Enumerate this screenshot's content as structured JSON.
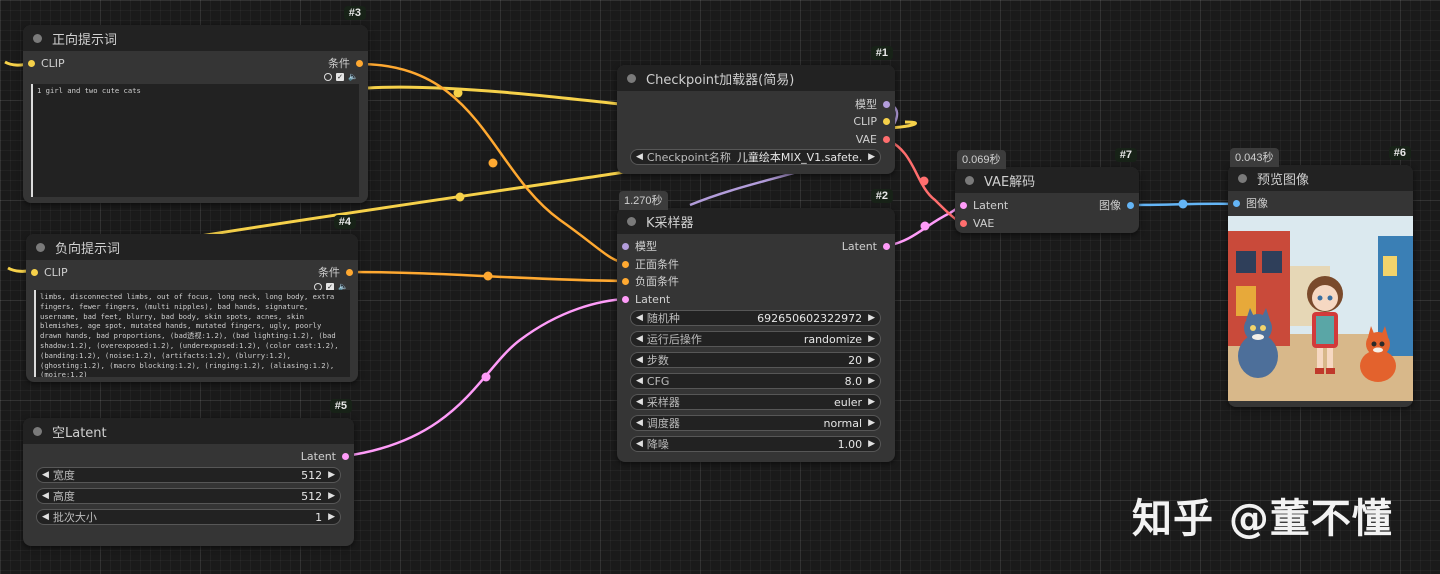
{
  "colors": {
    "clip": "#f6d14a",
    "conditioning": "#ffa931",
    "model": "#b39ddb",
    "vae": "#ff6e6e",
    "latent": "#ff9cf9",
    "image": "#64b5f6"
  },
  "nodes": {
    "positive_prompt": {
      "id": "#3",
      "title": "正向提示词",
      "input_clip": "CLIP",
      "output_condition": "条件",
      "text": "1 girl and two cute cats"
    },
    "checkpoint_loader": {
      "id": "#1",
      "title": "Checkpoint加载器(简易)",
      "output_model": "模型",
      "output_clip": "CLIP",
      "output_vae": "VAE",
      "ckpt_label": "Checkpoint名称",
      "ckpt_value": "儿童绘本MIX_V1.safete…"
    },
    "negative_prompt": {
      "id": "#4",
      "title": "负向提示词",
      "input_clip": "CLIP",
      "output_condition": "条件",
      "text": "limbs, disconnected limbs, out of focus, long neck, long body, extra fingers, fewer fingers, (multi nipples), bad hands, signature, username, bad feet, blurry, bad body, skin spots, acnes, skin blemishes, age spot, mutated hands, mutated fingers, ugly, poorly drawn hands, bad proportions, (bad透视:1.2), (bad lighting:1.2), (bad shadow:1.2), (overexposed:1.2), (underexposed:1.2), (color cast:1.2), (banding:1.2), (noise:1.2), (artifacts:1.2), (blurry:1.2), (ghosting:1.2), (macro blocking:1.2), (ringing:1.2), (aliasing:1.2), (moire:1.2)"
    },
    "ksampler": {
      "id": "#2",
      "time": "1.270秒",
      "title": "K采样器",
      "input_model": "模型",
      "input_positive": "正面条件",
      "input_negative": "负面条件",
      "input_latent": "Latent",
      "output_latent": "Latent",
      "widgets": [
        {
          "label": "随机种",
          "value": "692650602322972"
        },
        {
          "label": "运行后操作",
          "value": "randomize"
        },
        {
          "label": "步数",
          "value": "20"
        },
        {
          "label": "CFG",
          "value": "8.0"
        },
        {
          "label": "采样器",
          "value": "euler"
        },
        {
          "label": "调度器",
          "value": "normal"
        },
        {
          "label": "降噪",
          "value": "1.00"
        }
      ]
    },
    "empty_latent": {
      "id": "#5",
      "title": "空Latent",
      "output_latent": "Latent",
      "widgets": [
        {
          "label": "宽度",
          "value": "512"
        },
        {
          "label": "高度",
          "value": "512"
        },
        {
          "label": "批次大小",
          "value": "1"
        }
      ]
    },
    "vae_decode": {
      "id": "#7",
      "time": "0.069秒",
      "title": "VAE解码",
      "input_latent": "Latent",
      "input_vae": "VAE",
      "output_image": "图像"
    },
    "preview_image": {
      "id": "#6",
      "time": "0.043秒",
      "title": "预览图像",
      "input_image": "图像"
    }
  },
  "watermark": "知乎 @董不懂"
}
